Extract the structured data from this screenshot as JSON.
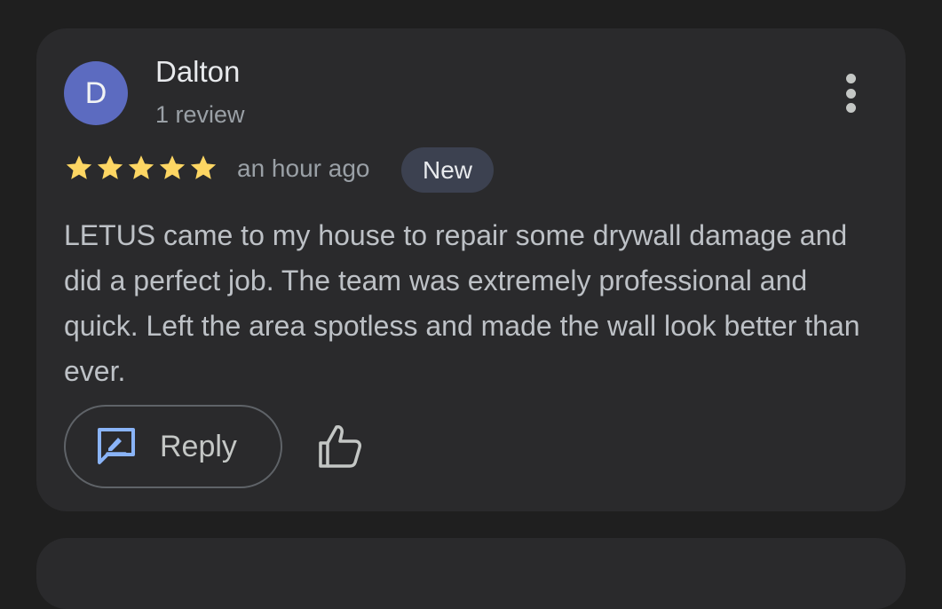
{
  "review": {
    "avatar_letter": "D",
    "reviewer_name": "Dalton",
    "review_count": "1 review",
    "rating": 5,
    "rating_max": 5,
    "time": "an hour ago",
    "badge": "New",
    "text": "LETUS came to my house to repair some drywall damage and did a perfect job. The team was extremely professional and quick. Left the area spotless and made the wall look better than ever.",
    "reply_label": "Reply"
  },
  "icons": {
    "more": "more-vertical-icon",
    "star": "star-icon",
    "reply": "reply-icon",
    "like": "thumbs-up-icon"
  },
  "colors": {
    "background": "#1f1f1f",
    "card": "#2a2a2c",
    "avatar": "#5c6bc0",
    "star": "#fdd663",
    "reply_icon": "#8ab4f8",
    "badge_bg": "#3c4150"
  }
}
